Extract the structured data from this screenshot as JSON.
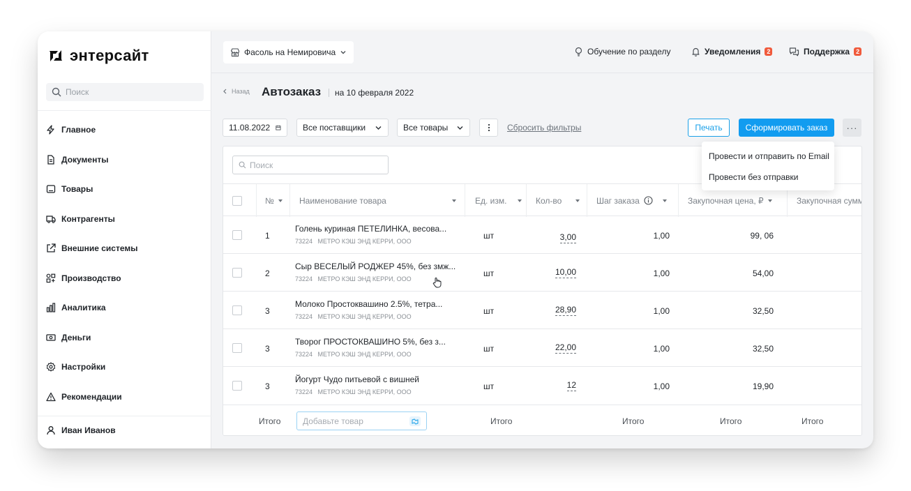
{
  "brand": {
    "name": "энтерсайт"
  },
  "sidebar": {
    "search_placeholder": "Поиск",
    "items": [
      {
        "label": "Главное",
        "icon": "bolt-icon"
      },
      {
        "label": "Документы",
        "icon": "document-icon"
      },
      {
        "label": "Товары",
        "icon": "product-icon"
      },
      {
        "label": "Контрагенты",
        "icon": "truck-icon"
      },
      {
        "label": "Внешние системы",
        "icon": "external-link-icon"
      },
      {
        "label": "Производство",
        "icon": "production-icon"
      },
      {
        "label": "Аналитика",
        "icon": "bar-chart-icon"
      },
      {
        "label": "Деньги",
        "icon": "money-icon"
      },
      {
        "label": "Настройки",
        "icon": "gear-icon"
      },
      {
        "label": "Рекомендации",
        "icon": "warning-icon"
      }
    ],
    "user": "Иван Иванов"
  },
  "topbar": {
    "store": "Фасоль на Немировича",
    "learn": "Обучение по разделу",
    "notifications": "Уведомления",
    "notifications_count": "2",
    "support": "Поддержка",
    "support_count": "2"
  },
  "header": {
    "back": "Назад",
    "title": "Автозаказ",
    "subtitle": "на 10 февраля 2022"
  },
  "filters": {
    "date": "11.08.2022",
    "suppliers": "Все поставщики",
    "goods": "Все товары",
    "reset": "Сбросить фильтры"
  },
  "actions": {
    "print": "Печать",
    "make_order": "Сформировать заказ",
    "more": "···"
  },
  "dropdown": {
    "items": [
      "Провести и отправить по Email",
      "Провести без отправки"
    ]
  },
  "table": {
    "search_placeholder": "Поиск",
    "columns": [
      "№",
      "Наименование товара",
      "Ед. изм.",
      "Кол-во",
      "Шаг заказа",
      "Закупочная цена, ₽",
      "Закупочная сумм"
    ],
    "rows": [
      {
        "num": "1",
        "name": "Голень куриная ПЕТЕЛИНКА, весова...",
        "code": "73224",
        "supplier": "МЕТРО КЭШ ЭНД КЕРРИ, ООО",
        "unit": "шт",
        "qty": "3,00",
        "step": "1,00",
        "price": "99, 06"
      },
      {
        "num": "2",
        "name": "Сыр ВЕСЕЛЫЙ РОДЖЕР 45%, без змж...",
        "code": "73224",
        "supplier": "МЕТРО КЭШ ЭНД КЕРРИ, ООО",
        "unit": "шт",
        "qty": "10,00",
        "step": "1,00",
        "price": "54,00"
      },
      {
        "num": "3",
        "name": "Молоко Простоквашино 2.5%, тетра...",
        "code": "73224",
        "supplier": "МЕТРО КЭШ ЭНД КЕРРИ, ООО",
        "unit": "шт",
        "qty": "28,90",
        "step": "1,00",
        "price": "32,50"
      },
      {
        "num": "3",
        "name": "Творог ПРОСТОКВАШИНО 5%, без з...",
        "code": "73224",
        "supplier": "МЕТРО КЭШ ЭНД КЕРРИ, ООО",
        "unit": "шт",
        "qty": "22,00",
        "step": "1,00",
        "price": "32,50"
      },
      {
        "num": "3",
        "name": "Йогурт Чудо питьевой с вишней",
        "code": "73224",
        "supplier": "МЕТРО КЭШ ЭНД КЕРРИ, ООО",
        "unit": "шт",
        "qty": "12",
        "step": "1,00",
        "price": "19,90"
      }
    ],
    "footer": {
      "total": "Итого",
      "add_placeholder": "Добавьте товар"
    }
  },
  "colors": {
    "accent": "#129cf0",
    "badge": "#f05a3c"
  }
}
